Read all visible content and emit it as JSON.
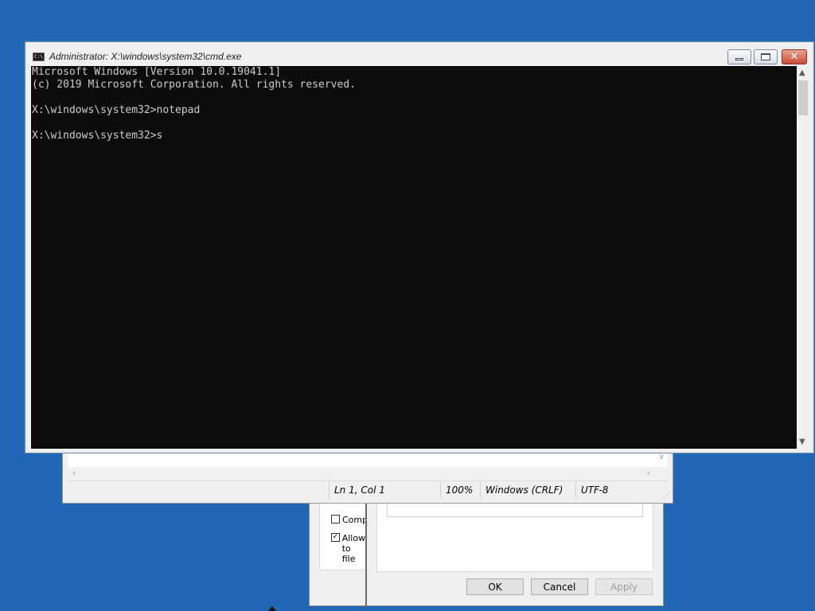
{
  "cmd": {
    "title": "Administrator: X:\\windows\\system32\\cmd.exe",
    "lines": [
      "Microsoft Windows [Version 10.0.19041.1]",
      "(c) 2019 Microsoft Corporation. All rights reserved.",
      "",
      "X:\\windows\\system32>notepad",
      "",
      "X:\\windows\\system32>s"
    ]
  },
  "notepad": {
    "status": {
      "position": "Ln 1, Col 1",
      "zoom": "100%",
      "line_ending": "Windows (CRLF)",
      "encoding": "UTF-8"
    }
  },
  "properties": {
    "checkbox_compress": {
      "label": "Comp",
      "checked": false
    },
    "checkbox_allow": {
      "label_line1": "Allow",
      "label_line2": "to file",
      "checked": true
    },
    "buttons": {
      "ok": "OK",
      "cancel": "Cancel",
      "apply": "Apply"
    }
  },
  "colors": {
    "desktop": "#2167b5",
    "console_bg": "#0c0c0c",
    "console_text": "#cccccc"
  }
}
